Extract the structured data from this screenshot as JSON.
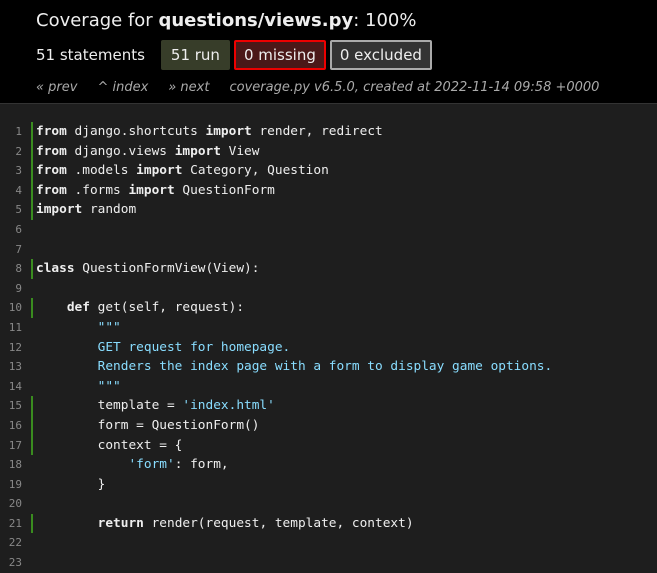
{
  "header": {
    "title_prefix": "Coverage for ",
    "filename": "questions/views.py",
    "title_suffix": ": 100%",
    "statements": "51 statements",
    "run": "51 run",
    "missing": "0 missing",
    "excluded": "0 excluded"
  },
  "nav": {
    "prev": "« prev",
    "index": "^ index",
    "next": "» next",
    "created": "coverage.py v6.5.0, created at 2022-11-14 09:58 +0000"
  },
  "colors": {
    "run_marker": "#3a8c1f",
    "missing_border": "#ee0000",
    "string": "#89ddff"
  },
  "lines": [
    {
      "n": "1",
      "run": true,
      "tokens": [
        {
          "t": "from",
          "c": "k"
        },
        {
          "t": " django.shortcuts "
        },
        {
          "t": "import",
          "c": "k"
        },
        {
          "t": " render, redirect"
        }
      ]
    },
    {
      "n": "2",
      "run": true,
      "tokens": [
        {
          "t": "from",
          "c": "k"
        },
        {
          "t": " django.views "
        },
        {
          "t": "import",
          "c": "k"
        },
        {
          "t": " View"
        }
      ]
    },
    {
      "n": "3",
      "run": true,
      "tokens": [
        {
          "t": "from",
          "c": "k"
        },
        {
          "t": " .models "
        },
        {
          "t": "import",
          "c": "k"
        },
        {
          "t": " Category, Question"
        }
      ]
    },
    {
      "n": "4",
      "run": true,
      "tokens": [
        {
          "t": "from",
          "c": "k"
        },
        {
          "t": " .forms "
        },
        {
          "t": "import",
          "c": "k"
        },
        {
          "t": " QuestionForm"
        }
      ]
    },
    {
      "n": "5",
      "run": true,
      "tokens": [
        {
          "t": "import",
          "c": "k"
        },
        {
          "t": " random"
        }
      ]
    },
    {
      "n": "6",
      "run": false,
      "tokens": []
    },
    {
      "n": "7",
      "run": false,
      "tokens": []
    },
    {
      "n": "8",
      "run": true,
      "tokens": [
        {
          "t": "class",
          "c": "k"
        },
        {
          "t": " QuestionFormView(View):"
        }
      ]
    },
    {
      "n": "9",
      "run": false,
      "tokens": []
    },
    {
      "n": "10",
      "run": true,
      "tokens": [
        {
          "t": "    "
        },
        {
          "t": "def",
          "c": "k"
        },
        {
          "t": " get(self, request):"
        }
      ]
    },
    {
      "n": "11",
      "run": false,
      "tokens": [
        {
          "t": "        "
        },
        {
          "t": "\"\"\"",
          "c": "s"
        }
      ]
    },
    {
      "n": "12",
      "run": false,
      "tokens": [
        {
          "t": "        "
        },
        {
          "t": "GET request for homepage.",
          "c": "s"
        }
      ]
    },
    {
      "n": "13",
      "run": false,
      "tokens": [
        {
          "t": "        "
        },
        {
          "t": "Renders the index page with a form to display game options.",
          "c": "s"
        }
      ]
    },
    {
      "n": "14",
      "run": false,
      "tokens": [
        {
          "t": "        "
        },
        {
          "t": "\"\"\"",
          "c": "s"
        }
      ]
    },
    {
      "n": "15",
      "run": true,
      "tokens": [
        {
          "t": "        template = "
        },
        {
          "t": "'index.html'",
          "c": "s"
        }
      ]
    },
    {
      "n": "16",
      "run": true,
      "tokens": [
        {
          "t": "        form = QuestionForm()"
        }
      ]
    },
    {
      "n": "17",
      "run": true,
      "tokens": [
        {
          "t": "        context = {"
        }
      ]
    },
    {
      "n": "18",
      "run": false,
      "tokens": [
        {
          "t": "            "
        },
        {
          "t": "'form'",
          "c": "s"
        },
        {
          "t": ": form,"
        }
      ]
    },
    {
      "n": "19",
      "run": false,
      "tokens": [
        {
          "t": "        }"
        }
      ]
    },
    {
      "n": "20",
      "run": false,
      "tokens": []
    },
    {
      "n": "21",
      "run": true,
      "tokens": [
        {
          "t": "        "
        },
        {
          "t": "return",
          "c": "k"
        },
        {
          "t": " render(request, template, context)"
        }
      ]
    },
    {
      "n": "22",
      "run": false,
      "tokens": []
    },
    {
      "n": "23",
      "run": false,
      "tokens": []
    }
  ]
}
